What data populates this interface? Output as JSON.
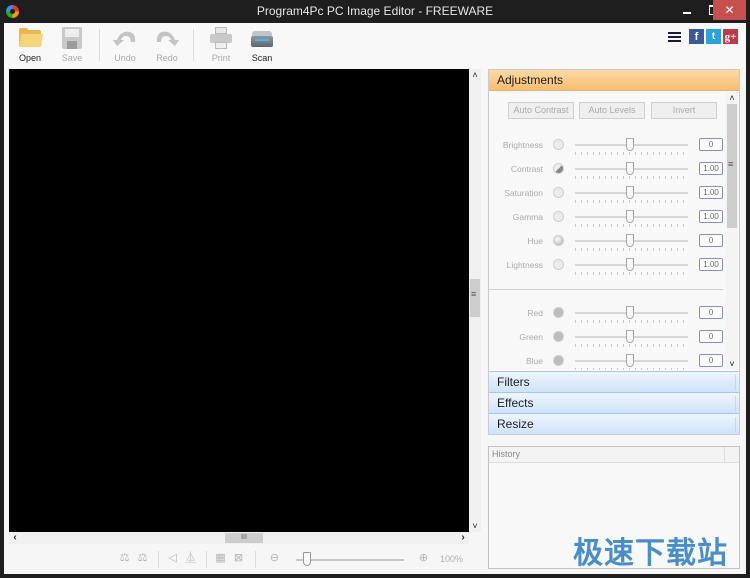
{
  "window": {
    "title": "Program4Pc PC Image Editor - FREEWARE",
    "close_glyph": "✕"
  },
  "toolbar": {
    "buttons": [
      {
        "id": "open",
        "label": "Open",
        "enabled": true
      },
      {
        "id": "save",
        "label": "Save",
        "enabled": false
      },
      {
        "id": "undo",
        "label": "Undo",
        "enabled": false
      },
      {
        "id": "redo",
        "label": "Redo",
        "enabled": false
      },
      {
        "id": "print",
        "label": "Print",
        "enabled": false
      },
      {
        "id": "scan",
        "label": "Scan",
        "enabled": true
      }
    ],
    "right_icons": [
      "list-icon",
      "facebook-icon",
      "twitter-icon",
      "google-plus-icon"
    ],
    "social": {
      "facebook": "f",
      "twitter": "t",
      "googleplus": "g+"
    }
  },
  "canvas": {
    "background": "#000000",
    "vscroll": {
      "up": "˄",
      "down": "˅"
    },
    "hscroll": {
      "left": "‹",
      "right": "›",
      "grip": "III"
    }
  },
  "bottom_tools": {
    "icons": [
      "flip-horizontal-icon",
      "flip-vertical-icon",
      "perspective-icon",
      "mirror-icon",
      "fit-icon",
      "actual-size-icon",
      "zoom-out-icon",
      "zoom-in-icon"
    ],
    "zoom_level": "100%",
    "zoom_slider_fraction": 0.1
  },
  "panel": {
    "sections": {
      "adjustments": "Adjustments",
      "filters": "Filters",
      "effects": "Effects",
      "resize": "Resize"
    },
    "adjust_buttons": [
      "Auto Contrast",
      "Auto Levels",
      "Invert"
    ],
    "adjustments": [
      {
        "name": "Brightness",
        "value": "0",
        "icon": "brightness-icon",
        "position": 0.5
      },
      {
        "name": "Contrast",
        "value": "1.00",
        "icon": "contrast-icon",
        "position": 0.5
      },
      {
        "name": "Saturation",
        "value": "1.00",
        "icon": "saturation-icon",
        "position": 0.5
      },
      {
        "name": "Gamma",
        "value": "1.00",
        "icon": "gamma-icon",
        "position": 0.5
      },
      {
        "name": "Hue",
        "value": "0",
        "icon": "hue-icon",
        "position": 0.5
      },
      {
        "name": "Lightness",
        "value": "1.00",
        "icon": "lightbulb-icon",
        "position": 0.5
      }
    ],
    "color_channels": [
      {
        "name": "Red",
        "value": "0",
        "icon": "red-channel-icon",
        "position": 0.5
      },
      {
        "name": "Green",
        "value": "0",
        "icon": "green-channel-icon",
        "position": 0.5
      },
      {
        "name": "Blue",
        "value": "0",
        "icon": "blue-channel-icon",
        "position": 0.5
      }
    ],
    "scroll": {
      "up": "˄",
      "down": "˅"
    }
  },
  "history": {
    "header": "History",
    "items": []
  },
  "watermark": "极速下载站",
  "colors": {
    "accent_orange": "#f8bd70",
    "section_blue": "#cfe3fa",
    "close_red": "#c7504f",
    "value_border": "#8b8bc9"
  }
}
